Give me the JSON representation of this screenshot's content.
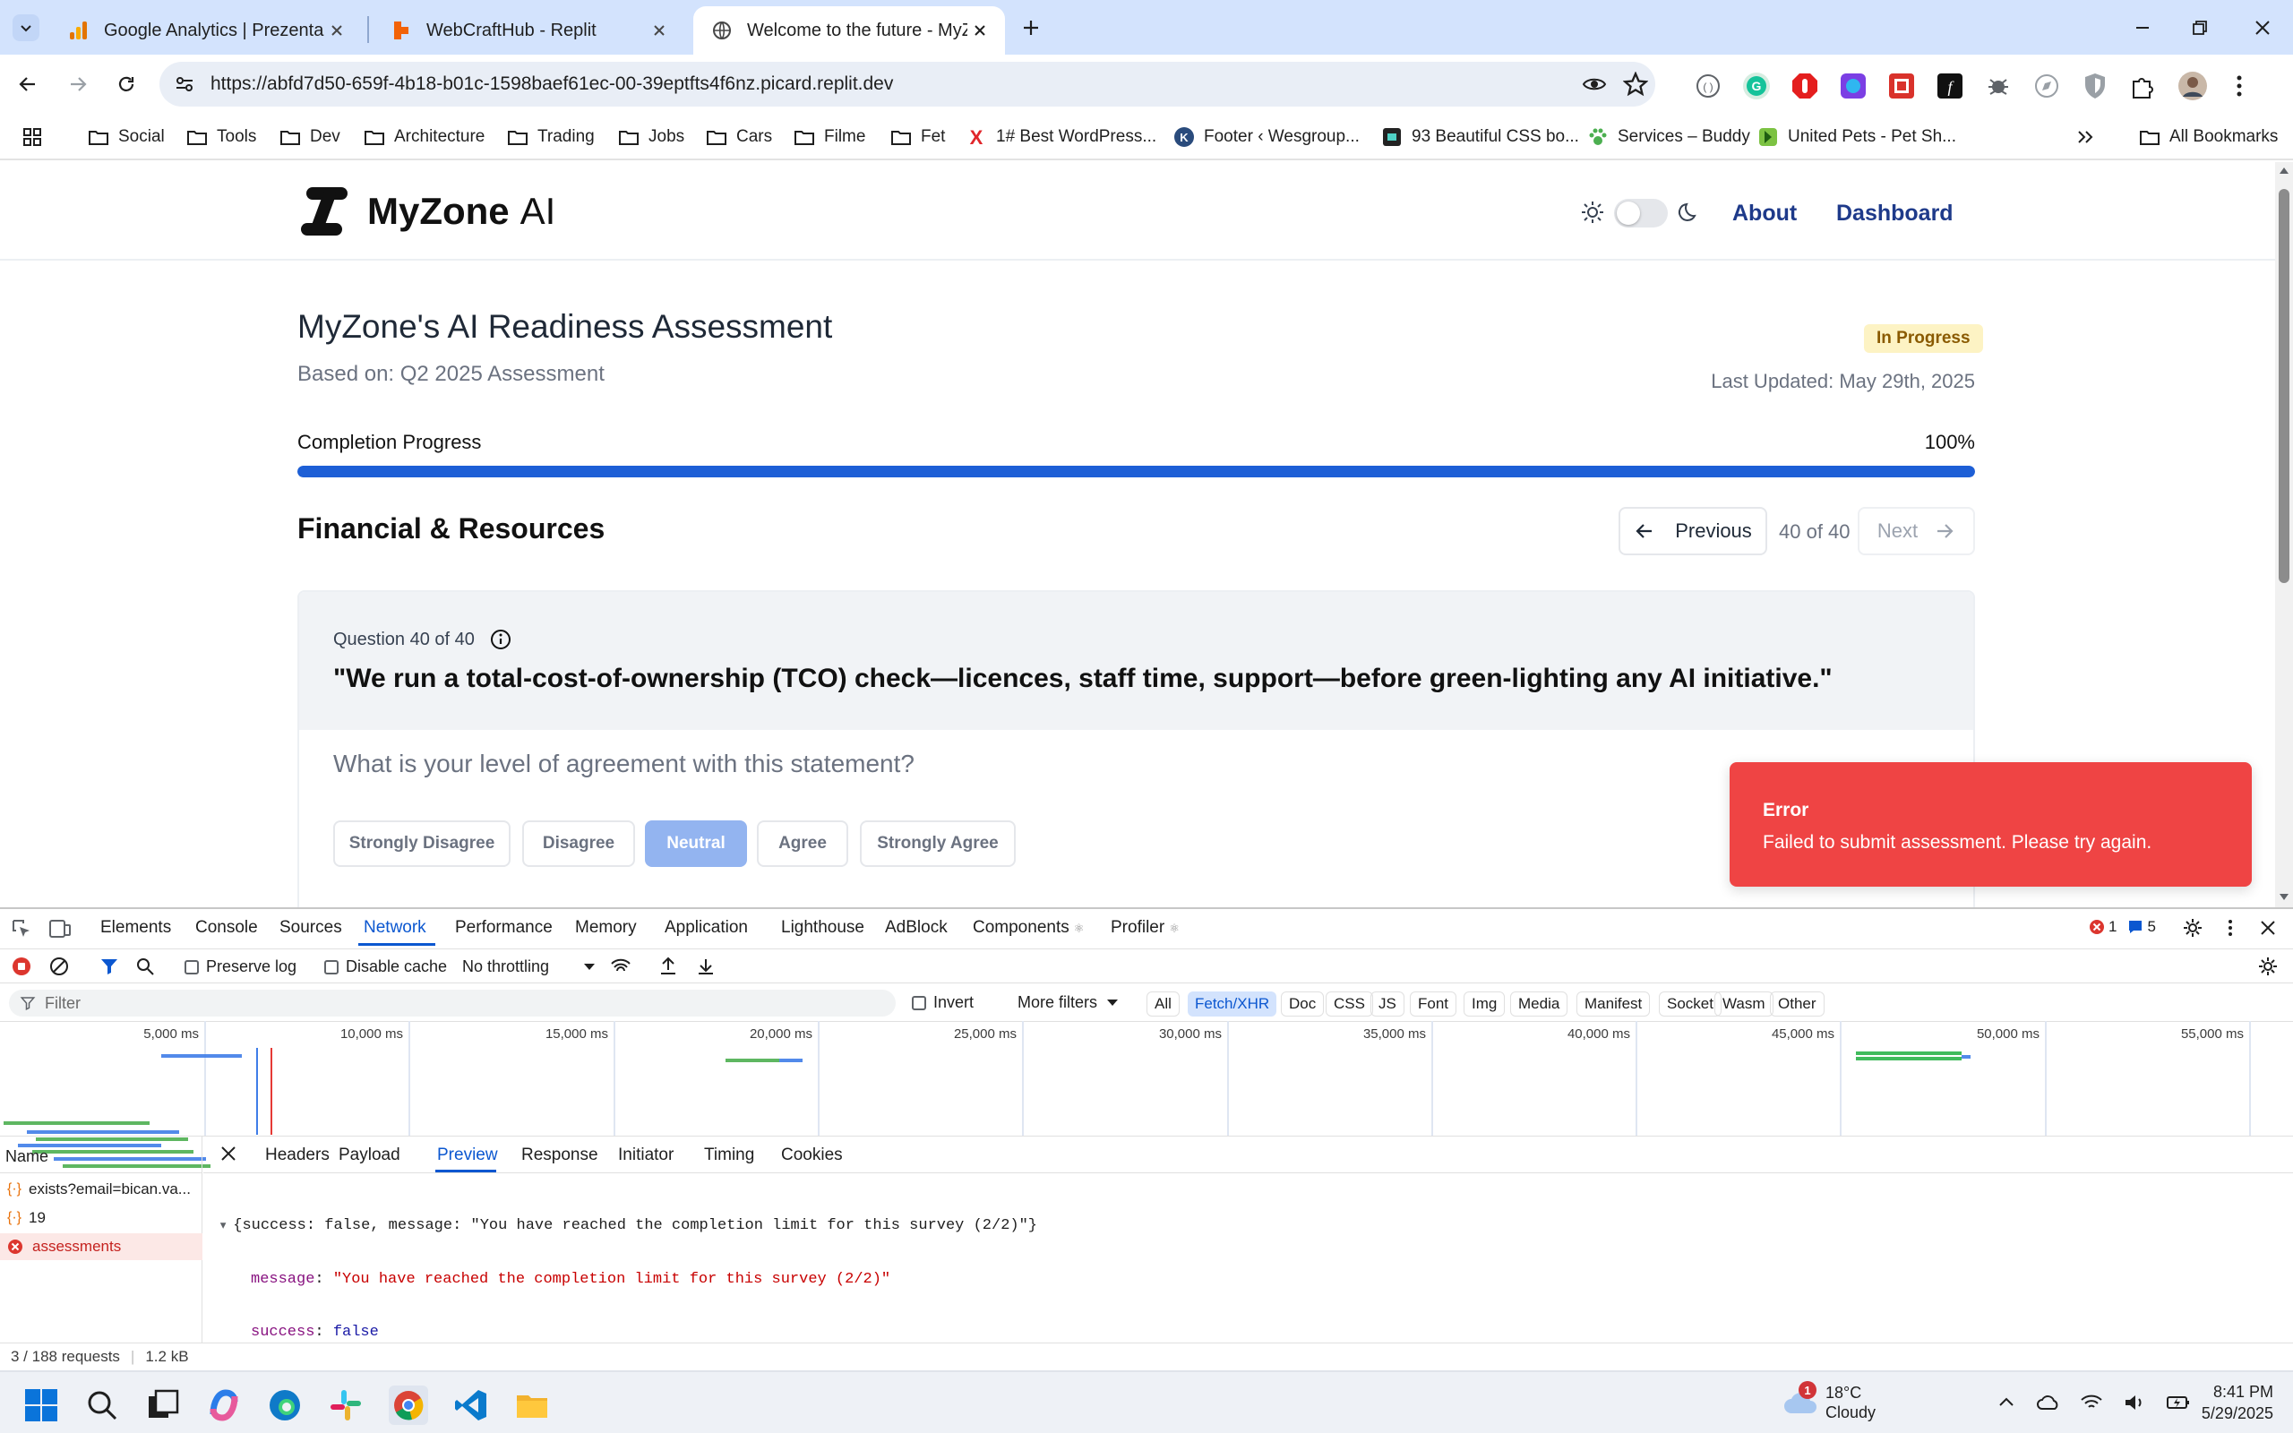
{
  "tabs": [
    {
      "title": "Google Analytics | Prezentare g",
      "icon": "google-analytics-icon",
      "active": false
    },
    {
      "title": "WebCraftHub - Replit",
      "icon": "replit-icon",
      "active": false
    },
    {
      "title": "Welcome to the future - MyZon",
      "icon": "globe-icon",
      "active": true
    }
  ],
  "address_bar": {
    "url": "https://abfd7d50-659f-4b18-b01c-1598baef61ec-00-39eptfts4f6nz.picard.replit.dev"
  },
  "bookmarks": {
    "folders": [
      "Social",
      "Tools",
      "Dev",
      "Architecture",
      "Trading",
      "Jobs",
      "Cars",
      "Filme",
      "Fet"
    ],
    "links": [
      "1# Best WordPress...",
      "Footer ‹ Wesgroup...",
      "93 Beautiful CSS bo...",
      "Services – Buddy",
      "United Pets - Pet Sh..."
    ],
    "all_bookmarks": "All Bookmarks"
  },
  "site": {
    "logo_main": "MyZone",
    "logo_suffix": "AI",
    "nav": {
      "about": "About",
      "dashboard": "Dashboard"
    }
  },
  "assessment": {
    "title": "MyZone's AI Readiness Assessment",
    "based_on": "Based on: Q2 2025 Assessment",
    "status": "In Progress",
    "last_updated": "Last Updated: May 29th, 2025",
    "progress_label": "Completion Progress",
    "progress_text": "100%",
    "progress_value": 100,
    "section": "Financial & Resources",
    "previous": "Previous",
    "page_counter": "40 of 40",
    "next": "Next",
    "question_number": "Question 40 of 40",
    "question_text": "\"We run a total-cost-of-ownership (TCO) check—licences, staff time, support—before green-lighting any AI initiative.\"",
    "prompt": "What is your level of agreement with this statement?",
    "answers": [
      "Strongly Disagree",
      "Disagree",
      "Neutral",
      "Agree",
      "Strongly Agree"
    ],
    "selected_answer": "Neutral"
  },
  "toast": {
    "title": "Error",
    "message": "Failed to submit assessment. Please try again.",
    "color": "#ef4444"
  },
  "devtools": {
    "tabs": [
      "Elements",
      "Console",
      "Sources",
      "Network",
      "Performance",
      "Memory",
      "Application",
      "Lighthouse",
      "AdBlock",
      "Components",
      "Profiler"
    ],
    "active_tab": "Network",
    "error_count": "1",
    "message_count": "5",
    "preserve_log": "Preserve log",
    "disable_cache": "Disable cache",
    "throttling": "No throttling",
    "filter_placeholder": "Filter",
    "invert": "Invert",
    "more_filters": "More filters",
    "type_filters": [
      "All",
      "Fetch/XHR",
      "Doc",
      "CSS",
      "JS",
      "Font",
      "Img",
      "Media",
      "Manifest",
      "Socket",
      "Wasm",
      "Other"
    ],
    "active_type_filter": "Fetch/XHR",
    "timeline_ticks": [
      "5,000 ms",
      "10,000 ms",
      "15,000 ms",
      "20,000 ms",
      "25,000 ms",
      "30,000 ms",
      "35,000 ms",
      "40,000 ms",
      "45,000 ms",
      "50,000 ms",
      "55,000 ms"
    ],
    "name_header": "Name",
    "requests": [
      {
        "name": "exists?email=bican.va...",
        "error": false
      },
      {
        "name": "19",
        "error": false
      },
      {
        "name": "assessments",
        "error": true
      }
    ],
    "detail_tabs": [
      "Headers",
      "Payload",
      "Preview",
      "Response",
      "Initiator",
      "Timing",
      "Cookies"
    ],
    "active_detail_tab": "Preview",
    "preview": {
      "summary": "{success: false, message: \"You have reached the completion limit for this survey (2/2)\"}",
      "message_key": "message",
      "message_value": "\"You have reached the completion limit for this survey (2/2)\"",
      "success_key": "success",
      "success_value": "false"
    },
    "status_requests": "3 / 188 requests",
    "status_size": "1.2 kB"
  },
  "taskbar": {
    "weather_temp": "18°C",
    "weather_desc": "Cloudy",
    "weather_badge": "1",
    "time": "8:41 PM",
    "date": "5/29/2025"
  },
  "colors": {
    "accent": "#1d5fd6",
    "nav_link": "#1e3a8a",
    "error": "#ef4444",
    "chrome_tabstrip": "#d3e3fd"
  }
}
